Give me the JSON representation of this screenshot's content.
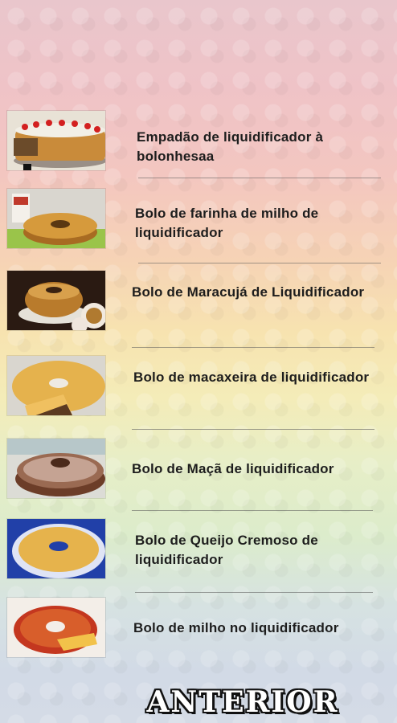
{
  "recipes": [
    {
      "title": "Empadão de liquidificador à bolonhesaa",
      "image": "cake-with-strawberries-icon"
    },
    {
      "title": "Bolo de farinha de milho de liquidificador",
      "image": "ring-cake-icon"
    },
    {
      "title": "Bolo de Maracujá de Liquidificador",
      "image": "passion-fruit-cake-icon"
    },
    {
      "title": "Bolo de macaxeira de liquidificador",
      "image": "sliced-ring-cake-icon"
    },
    {
      "title": "Bolo de Maçã de liquidificador",
      "image": "apple-ring-cake-icon"
    },
    {
      "title": "Bolo de Queijo Cremoso de liquidificador",
      "image": "cheese-cake-icon"
    },
    {
      "title": "Bolo de milho no liquidificador",
      "image": "corn-cake-icon"
    }
  ],
  "navigation": {
    "previous_label": "ANTERIOR"
  }
}
